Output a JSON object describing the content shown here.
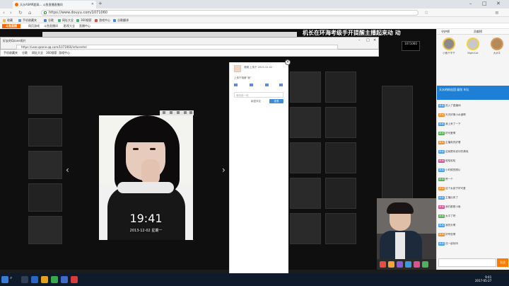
{
  "browser": {
    "tab_title": "天水ASMR超高... 斗鱼直播直播间",
    "url": "https://www.douyu.com/1071060",
    "new_tab": "+",
    "bookmarks": [
      "收藏",
      "手机收藏夹",
      "谷歌",
      "网址大全",
      "360搜索",
      "游戏中心",
      "谷歌翻译"
    ],
    "bookmarks2": [
      "网页游戏",
      "斗鱼直播间",
      "影视大全",
      "直播中心"
    ]
  },
  "site": {
    "logo": "斗鱼直播"
  },
  "stream": {
    "marquee": "机长在环海考级手开提醒主播起来动  动",
    "room_id": "1071060"
  },
  "inner_browser": {
    "title": "好友的Qzone照片",
    "url": "https://user.qzone.qq.com/1071060/infocenter",
    "bookmarks": [
      "手机收藏夹",
      "谷歌",
      "网址大全",
      "360搜索",
      "游戏中心"
    ]
  },
  "photo": {
    "time": "19:41",
    "date": "2013-12-02 星期一"
  },
  "comments": {
    "user": "湘湘 上传于 2013-12-02",
    "caption": "上传于相册“我”",
    "placeholder": "我也说一句",
    "private": "私密评论",
    "send": "发表"
  },
  "sidebar": {
    "tabs": [
      "守护榜",
      "贡献榜"
    ],
    "ranks": [
      {
        "name": "小鱼干不干"
      },
      {
        "name": "NightCat"
      },
      {
        "name": "大水牛"
      }
    ],
    "banner": "天水的粉丝团 级别 车队",
    "chat": [
      {
        "badge": "水水",
        "color": "#4c9be8",
        "text": "进入了直播间"
      },
      {
        "badge": "水水",
        "color": "#f08c2a",
        "text": "天天好像小水道啊"
      },
      {
        "badge": "水水",
        "color": "#4c9be8",
        "text": "我上来了一下"
      },
      {
        "badge": "水水",
        "color": "#55b055",
        "text": "好可爱啊"
      },
      {
        "badge": "水水",
        "color": "#f08c2a",
        "text": "主播真的好看"
      },
      {
        "badge": "水水",
        "color": "#4c9be8",
        "text": "这就是传说中的清纯"
      },
      {
        "badge": "水水",
        "color": "#d04f8e",
        "text": "哈哈哈哈"
      },
      {
        "badge": "水水",
        "color": "#4c9be8",
        "text": "小时候的照片"
      },
      {
        "badge": "水水",
        "color": "#55b055",
        "text": "赞一个"
      },
      {
        "badge": "水水",
        "color": "#f08c2a",
        "text": "这个女孩子好可爱"
      },
      {
        "badge": "水水",
        "color": "#4c9be8",
        "text": "主播出来了"
      },
      {
        "badge": "水水",
        "color": "#d04f8e",
        "text": "我们都是小鱼"
      },
      {
        "badge": "水水",
        "color": "#55b055",
        "text": "太平了吧"
      },
      {
        "badge": "水水",
        "color": "#4c9be8",
        "text": "我的天啊"
      },
      {
        "badge": "水水",
        "color": "#f08c2a",
        "text": "好夸张啊"
      },
      {
        "badge": "水水",
        "color": "#4c9be8",
        "text": "还一起玩吗"
      }
    ],
    "send": "发送"
  },
  "taskbar": {
    "clock_time": "9:41",
    "clock_date": "2017-05-27"
  }
}
